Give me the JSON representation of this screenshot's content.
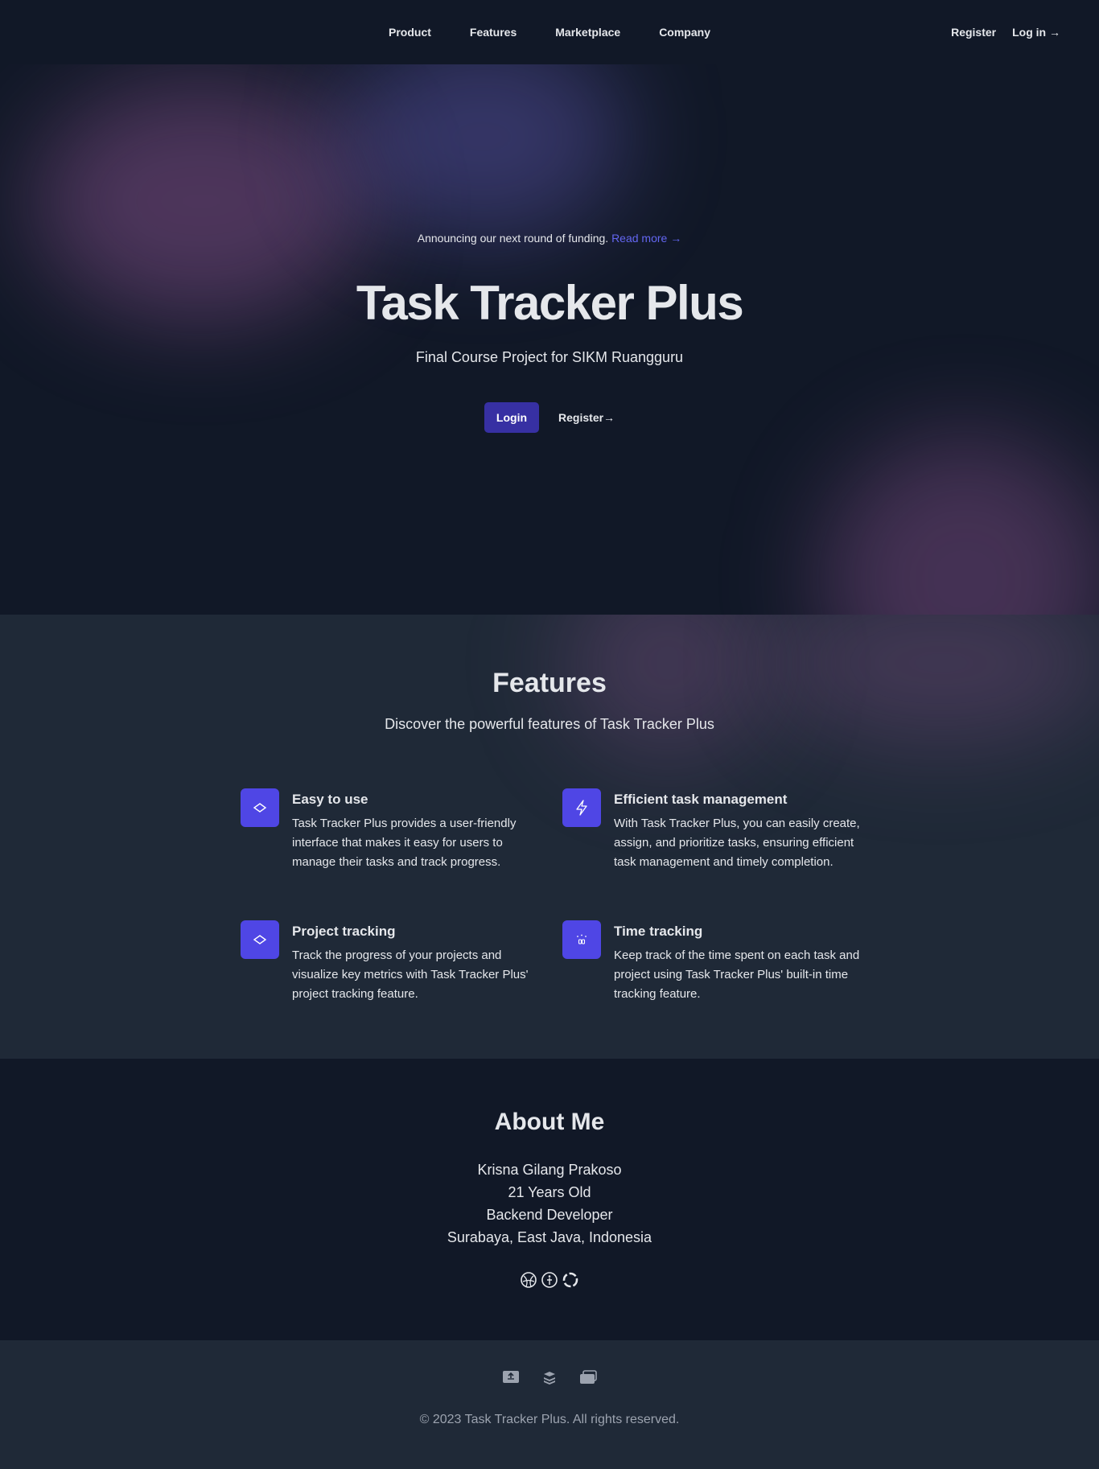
{
  "nav": {
    "items": [
      {
        "label": "Product"
      },
      {
        "label": "Features"
      },
      {
        "label": "Marketplace"
      },
      {
        "label": "Company"
      }
    ],
    "register_label": "Register",
    "login_label": "Log in →"
  },
  "hero": {
    "announcement": "Announcing our next round of funding.",
    "announcement_link": "Read more →",
    "title": "Task Tracker Plus",
    "subtitle": "Final Course Project for SIKM Ruangguru",
    "login_button": "Login",
    "register_link": "Register→"
  },
  "features": {
    "title": "Features",
    "subtitle": "Discover the powerful features of Task Tracker Plus",
    "items": [
      {
        "icon": "diamond-icon",
        "title": "Easy to use",
        "description": "Task Tracker Plus provides a user-friendly interface that makes it easy for users to manage their tasks and track progress."
      },
      {
        "icon": "bolt-icon",
        "title": "Efficient task management",
        "description": "With Task Tracker Plus, you can easily create, assign, and prioritize tasks, ensuring efficient task management and timely completion."
      },
      {
        "icon": "diamond-icon",
        "title": "Project tracking",
        "description": "Track the progress of your projects and visualize key metrics with Task Tracker Plus' project tracking feature."
      },
      {
        "icon": "clock-icon",
        "title": "Time tracking",
        "description": "Keep track of the time spent on each task and project using Task Tracker Plus' built-in time tracking feature."
      }
    ]
  },
  "about": {
    "title": "About Me",
    "lines": [
      "Krisna Gilang Prakoso",
      "21 Years Old",
      "Backend Developer",
      "Surabaya, East Java, Indonesia"
    ],
    "icons": [
      "basketball-icon",
      "person-icon",
      "github-icon"
    ]
  },
  "footer": {
    "icons": [
      "presentation-icon",
      "layers-icon",
      "folder-icon"
    ],
    "copyright": "© 2023 Task Tracker Plus. All rights reserved."
  },
  "colors": {
    "background": "#111827",
    "section": "#1f2937",
    "accent": "#4f46e5",
    "button": "#3730a3",
    "link": "#6366f1"
  }
}
